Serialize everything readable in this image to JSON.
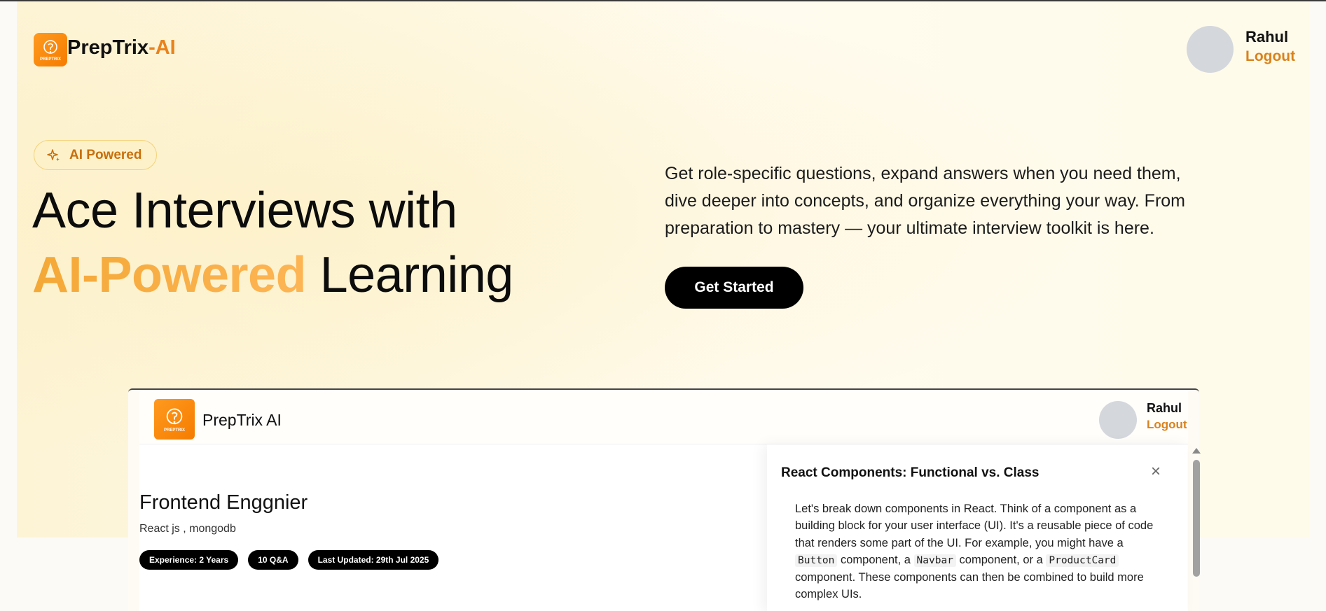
{
  "header": {
    "brand_main": "PrepTrix",
    "brand_accent": "-AI",
    "logo_small_text": "PREPTRIX",
    "user_name": "Rahul",
    "logout_label": "Logout"
  },
  "hero": {
    "badge": "AI Powered",
    "title_line1": "Ace Interviews with",
    "title_accent": "AI-Powered",
    "title_rest": " Learning",
    "description": "Get role-specific questions, expand answers when you need them, dive deeper into concepts, and organize everything your way. From preparation to mastery — your ultimate interview toolkit is here.",
    "cta_label": "Get Started"
  },
  "preview": {
    "brand": "PrepTrix AI",
    "logo_small_text": "PREPTRIX",
    "user_name": "Rahul",
    "logout_label": "Logout",
    "session_title": "Frontend Enggnier",
    "session_topics": "React js , mongodb",
    "pills": [
      "Experience: 2 Years",
      "10 Q&A",
      "Last Updated: 29th Jul 2025"
    ],
    "drawer": {
      "title": "React Components: Functional vs. Class",
      "close_icon": "×",
      "body_part1": "Let's break down components in React. Think of a component as a building block for your user interface (UI). It's a reusable piece of code that renders some part of the UI. For example, you might have a ",
      "code1": "Button",
      "body_part2": " component, a ",
      "code2": "Navbar",
      "body_part3": " component, or a ",
      "code3": "ProductCard",
      "body_part4": " component. These components can then be combined to build more complex UIs."
    }
  },
  "colors": {
    "accent": "#e9821d",
    "cta": "#000000",
    "badge_bg": "#fdf1c9"
  }
}
